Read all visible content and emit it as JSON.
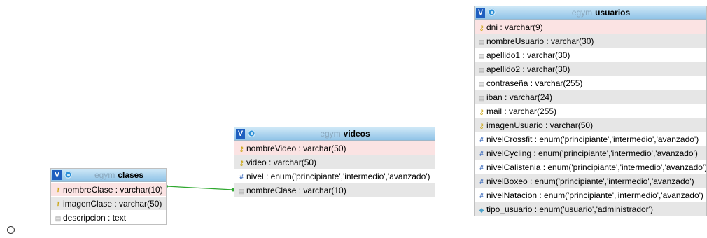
{
  "tables": {
    "clases": {
      "db": "egym",
      "name": "clases",
      "v_label": "V",
      "columns": [
        {
          "text": "nombreClase : varchar(10)",
          "icon": "key-icon",
          "bg": "pk"
        },
        {
          "text": "imagenClase : varchar(50)",
          "icon": "key-icon",
          "bg": "alt"
        },
        {
          "text": "descripcion : text",
          "icon": "text-field-icon",
          "bg": "plain"
        }
      ]
    },
    "videos": {
      "db": "egym",
      "name": "videos",
      "v_label": "V",
      "columns": [
        {
          "text": "nombreVideo : varchar(50)",
          "icon": "key-icon",
          "bg": "pk"
        },
        {
          "text": "video : varchar(50)",
          "icon": "key-icon",
          "bg": "alt"
        },
        {
          "text": "nivel : enum('principiante','intermedio','avanzado')",
          "icon": "number-icon",
          "bg": "plain"
        },
        {
          "text": "nombreClase : varchar(10)",
          "icon": "text-field-icon",
          "bg": "alt"
        }
      ]
    },
    "usuarios": {
      "db": "egym",
      "name": "usuarios",
      "v_label": "V",
      "columns": [
        {
          "text": "dni : varchar(9)",
          "icon": "key-icon",
          "bg": "pk"
        },
        {
          "text": "nombreUsuario : varchar(30)",
          "icon": "text-field-icon",
          "bg": "alt"
        },
        {
          "text": "apellido1 : varchar(30)",
          "icon": "text-field-icon",
          "bg": "plain"
        },
        {
          "text": "apellido2 : varchar(30)",
          "icon": "text-field-icon",
          "bg": "alt"
        },
        {
          "text": "contraseña : varchar(255)",
          "icon": "text-field-icon",
          "bg": "plain"
        },
        {
          "text": "iban : varchar(24)",
          "icon": "text-field-icon",
          "bg": "alt"
        },
        {
          "text": "mail : varchar(255)",
          "icon": "key-icon",
          "bg": "plain"
        },
        {
          "text": "imagenUsuario : varchar(50)",
          "icon": "key-icon",
          "bg": "alt"
        },
        {
          "text": "nivelCrossfit : enum('principiante','intermedio','avanzado')",
          "icon": "number-icon",
          "bg": "plain"
        },
        {
          "text": "nivelCycling : enum('principiante','intermedio','avanzado')",
          "icon": "number-icon",
          "bg": "alt"
        },
        {
          "text": "nivelCalistenia : enum('principiante','intermedio','avanzado')",
          "icon": "number-icon",
          "bg": "plain"
        },
        {
          "text": "nivelBoxeo : enum('principiante','intermedio','avanzado')",
          "icon": "number-icon",
          "bg": "alt"
        },
        {
          "text": "nivelNatacion : enum('principiante','intermedio','avanzado')",
          "icon": "number-icon",
          "bg": "plain"
        },
        {
          "text": "tipo_usuario : enum('usuario','administrador')",
          "icon": "enum-dot-icon",
          "bg": "alt"
        }
      ]
    }
  },
  "colors": {
    "relation_line": "#2fa82f"
  }
}
